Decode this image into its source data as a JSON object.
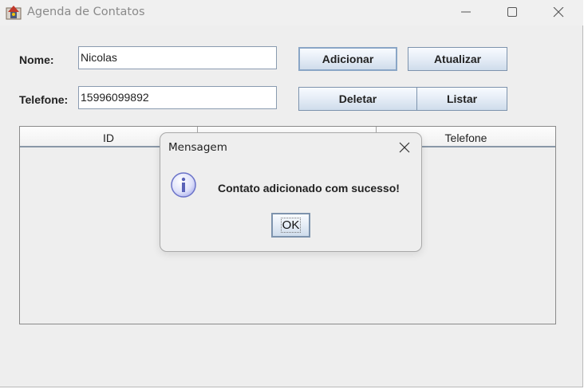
{
  "window": {
    "title": "Agenda de Contatos",
    "controls": [
      "minimize-icon",
      "maximize-icon",
      "close-icon"
    ]
  },
  "form": {
    "nome_label": "Nome:",
    "nome_value": "Nicolas",
    "telefone_label": "Telefone:",
    "telefone_value": "15996099892"
  },
  "buttons": {
    "adicionar": "Adicionar",
    "atualizar": "Atualizar",
    "deletar": "Deletar",
    "listar": "Listar"
  },
  "table": {
    "columns": [
      "ID",
      "",
      "Telefone"
    ],
    "rows": []
  },
  "dialog": {
    "title": "Mensagem",
    "icon": "info-icon",
    "message": "Contato adicionado com sucesso!",
    "ok_label": "OK"
  },
  "colors": {
    "window_bg": "#eeeeee",
    "button_border": "#7d93ad",
    "info_icon": "#6a72c8"
  }
}
